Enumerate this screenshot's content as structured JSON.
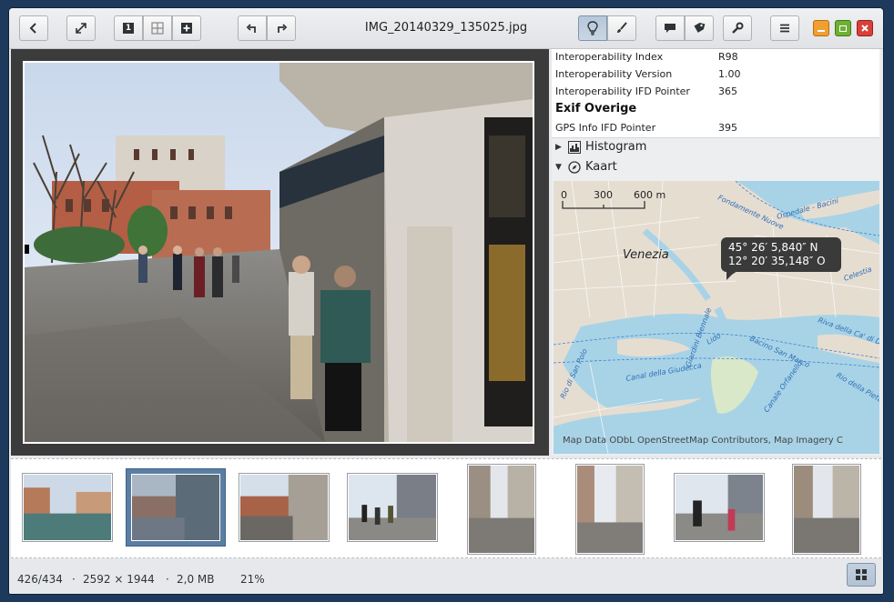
{
  "window": {
    "title": "IMG_20140329_135025.jpg"
  },
  "toolbar": {
    "back_icon": "chevron-left-icon",
    "fullscreen_icon": "expand-icon",
    "view_single_icon": "view-single-icon",
    "view_single_label": "1",
    "view_grid_icon": "view-grid-icon",
    "view_add_icon": "plus-icon",
    "rotate_left_icon": "rotate-left-icon",
    "rotate_right_icon": "rotate-right-icon",
    "info_icon": "lightbulb-icon",
    "edit_icon": "brush-icon",
    "comment_icon": "comment-icon",
    "tag_icon": "tag-icon",
    "tools_icon": "wrench-icon",
    "menu_icon": "hamburger-icon"
  },
  "window_controls": {
    "minimize_color": "#f0a030",
    "maximize_color": "#6fb034",
    "close_color": "#d9403a"
  },
  "properties": {
    "rows": [
      {
        "key": "Interoperability Index",
        "value": "R98"
      },
      {
        "key": "Interoperability Version",
        "value": "1.00"
      },
      {
        "key": "Interoperability IFD Pointer",
        "value": "365"
      }
    ],
    "section_heading": "Exif Overige",
    "gps_row": {
      "key": "GPS Info IFD Pointer",
      "value": "395"
    }
  },
  "sections": {
    "histogram": "Histogram",
    "map": "Kaart"
  },
  "map": {
    "scale_labels": [
      "0",
      "300",
      "600 m"
    ],
    "city_label": "Venezia",
    "coord_lat": "45° 26′ 5,840″ N",
    "coord_lon": "12° 20′ 35,148″ O",
    "attribution": "Map Data ODbL OpenStreetMap Contributors, Map Imagery C",
    "street_labels": [
      "Fondamente Nuove",
      "Ospedale - Bacini",
      "Celestia",
      "Riva della Ca' di Dio",
      "Bacino San Marco",
      "Giardini Biennale",
      "Lido",
      "Canale Orfanello",
      "Rio di San Polo",
      "Canal della Giudecca",
      "Rio della Pieta"
    ]
  },
  "filmstrip": {
    "selected_index": 1,
    "count": 8
  },
  "status": {
    "position": "426/434",
    "sep1": "·",
    "dimensions": "2592 × 1944",
    "sep2": "·",
    "filesize": "2,0 MB",
    "zoom": "21%",
    "grid_icon": "grid-view-icon"
  }
}
